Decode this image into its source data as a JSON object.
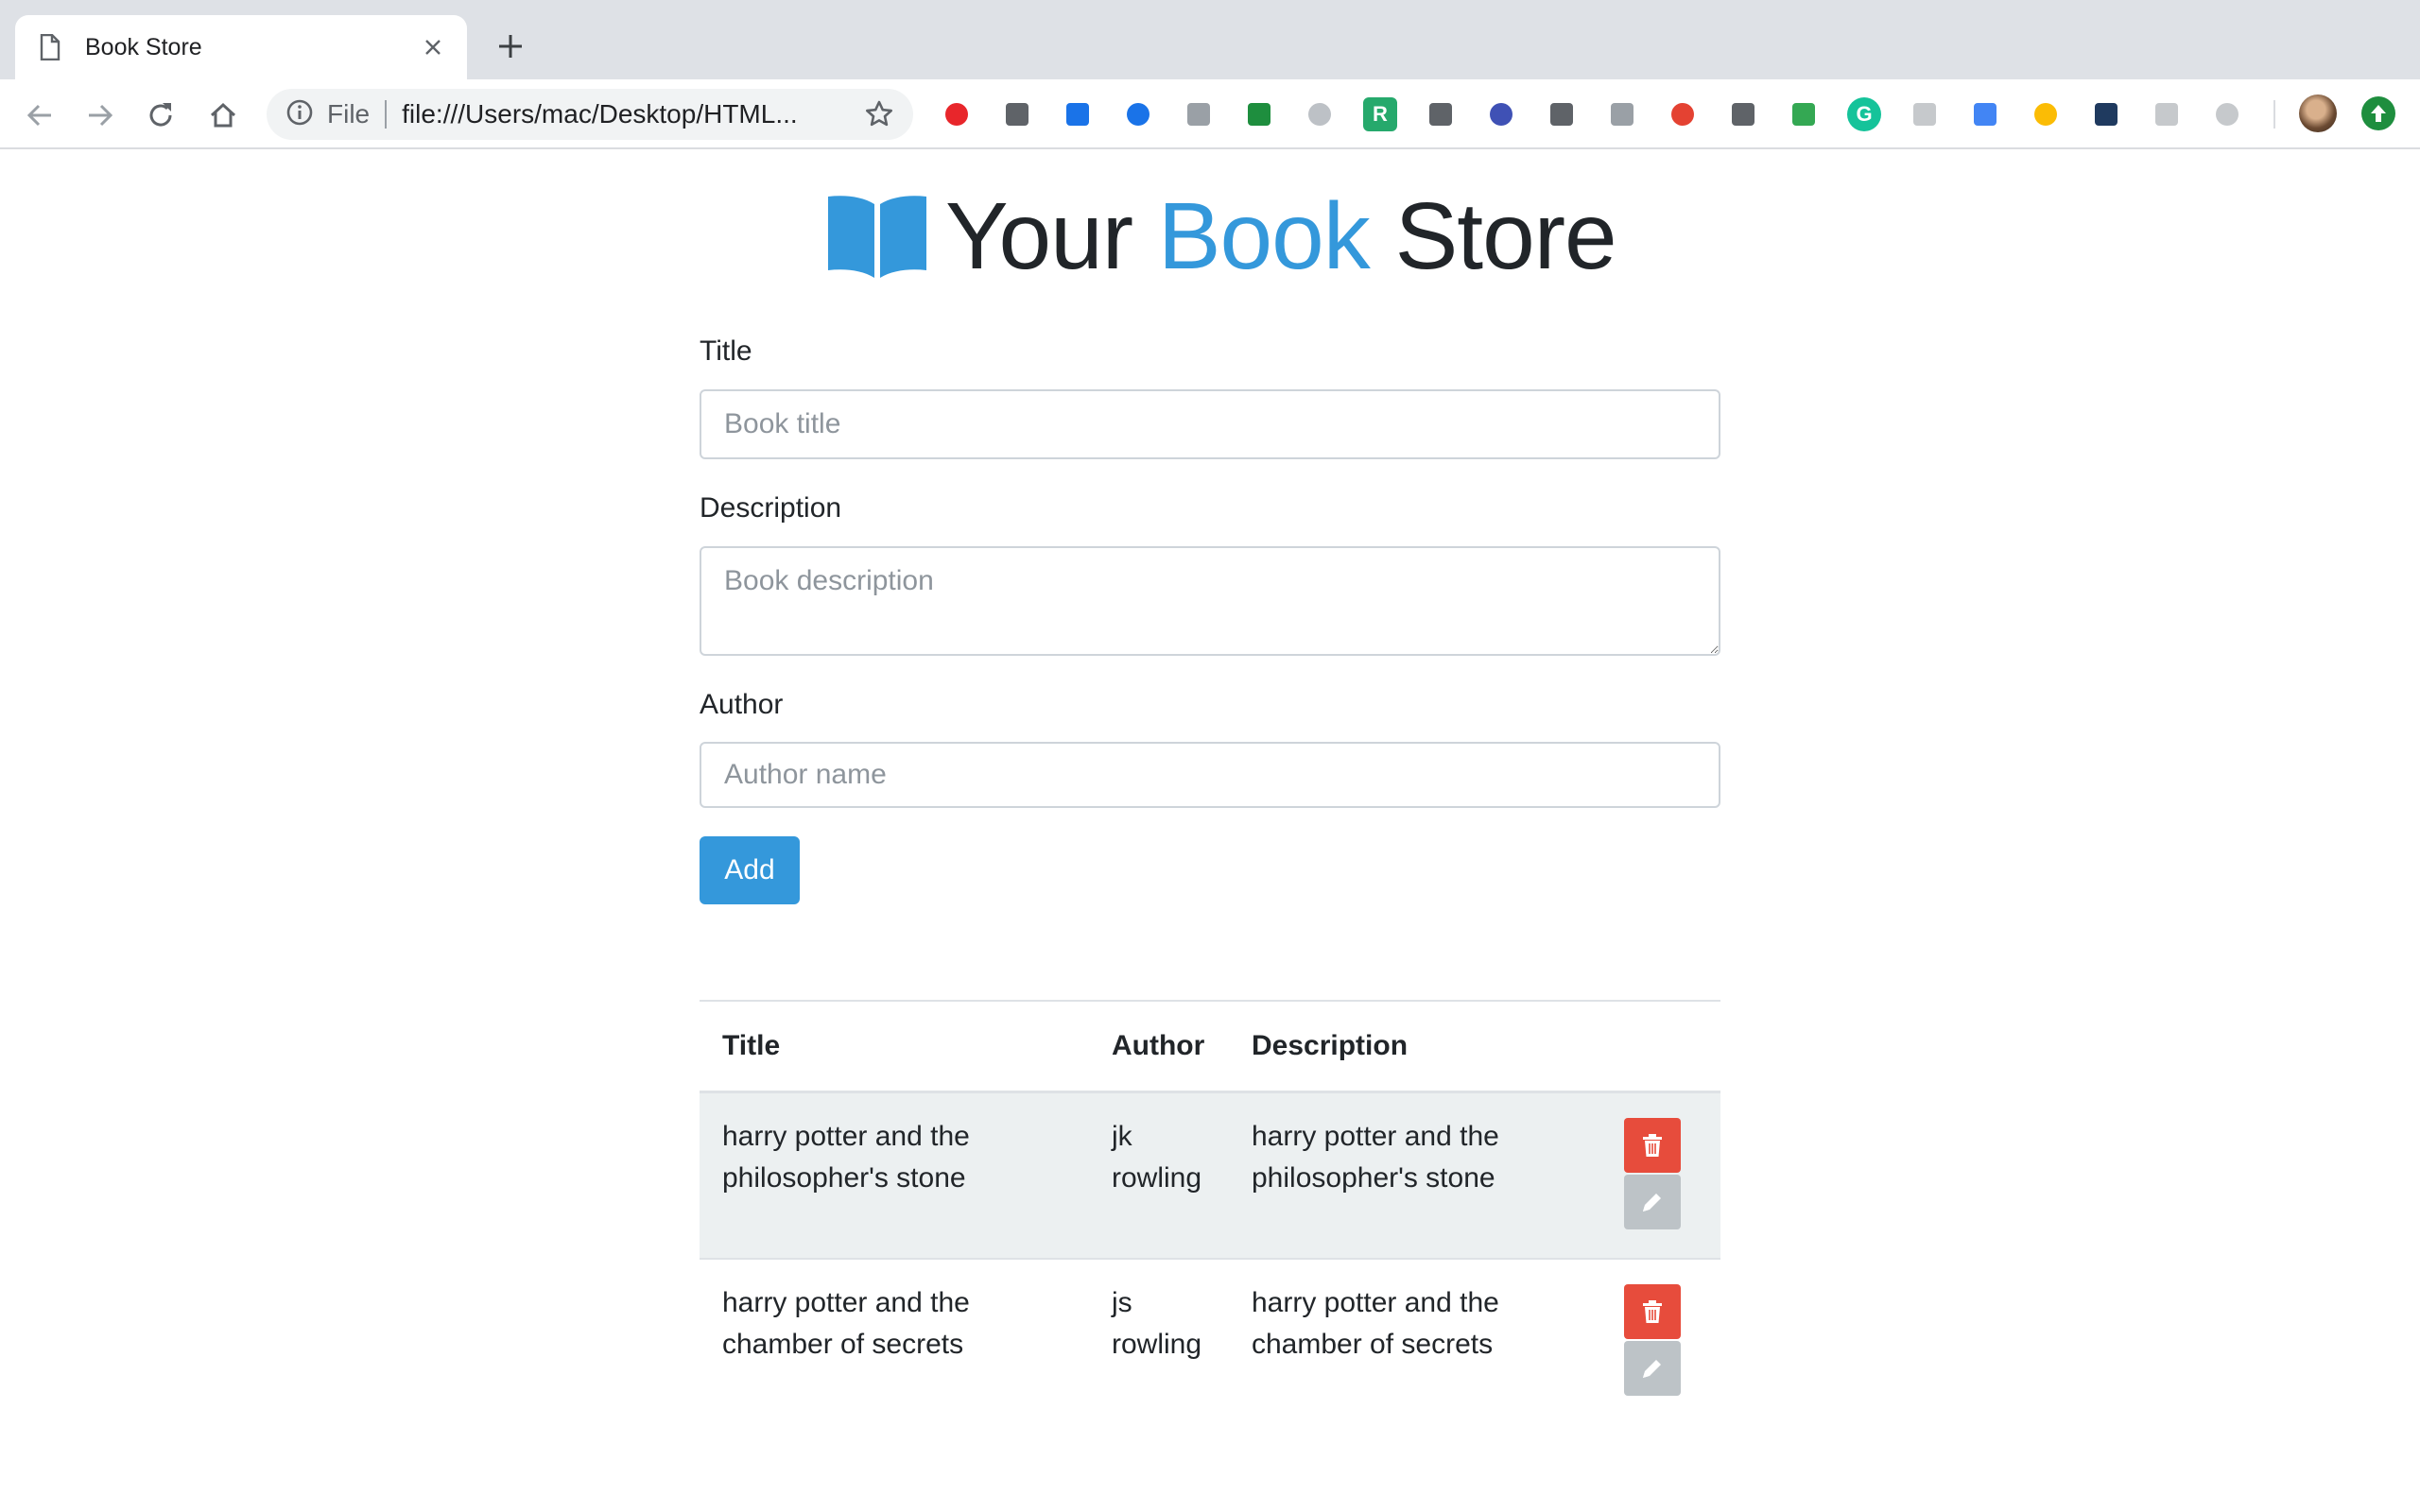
{
  "browser": {
    "tab": {
      "title": "Book Store"
    },
    "omnibox": {
      "scheme": "File",
      "url": "file:///Users/mac/Desktop/HTML..."
    },
    "extensions": [
      {
        "name": "adblock-icon",
        "color": "#e8262b"
      },
      {
        "name": "formula-icon",
        "color": "#5f6368"
      },
      {
        "name": "amazon-assistant-icon",
        "color": "#1a73e8"
      },
      {
        "name": "analytics-icon",
        "color": "#1a73e8"
      },
      {
        "name": "paint-icon",
        "color": "#9aa0a6"
      },
      {
        "name": "screenshot-frame-icon",
        "color": "#1e8e3e"
      },
      {
        "name": "camera-icon",
        "color": "#bdc1c6"
      },
      {
        "name": "r-extension-icon",
        "color": "#26a96c",
        "glyph": "R"
      },
      {
        "name": "bulb-icon",
        "color": "#5f6368"
      },
      {
        "name": "chevron-up-icon",
        "color": "#3f51b5"
      },
      {
        "name": "seo-icon",
        "color": "#5f6368"
      },
      {
        "name": "png-icon",
        "color": "#9aa0a6"
      },
      {
        "name": "todoist-icon",
        "color": "#e44232"
      },
      {
        "name": "layers-icon",
        "color": "#5f6368"
      },
      {
        "name": "eyedropper-icon",
        "color": "#34a853"
      },
      {
        "name": "grammarly-icon",
        "color": "#15c39a",
        "glyph": "G"
      },
      {
        "name": "react-devtools-icon",
        "color": "#c6c9cc"
      },
      {
        "name": "google-translate-icon",
        "color": "#4285f4"
      },
      {
        "name": "color-bars-icon",
        "color": "#fbbc05"
      },
      {
        "name": "server-icon",
        "color": "#1f3a5f"
      },
      {
        "name": "opera-icon",
        "color": "#c6c9cc"
      },
      {
        "name": "video-icon",
        "color": "#c6c9cc"
      }
    ]
  },
  "page": {
    "brand": {
      "your": "Your",
      "book": "Book",
      "store": "Store",
      "accent_color": "#3498db"
    },
    "form": {
      "title_label": "Title",
      "title_placeholder": "Book title",
      "description_label": "Description",
      "description_placeholder": "Book description",
      "author_label": "Author",
      "author_placeholder": "Author name",
      "add_label": "Add"
    },
    "table": {
      "headers": [
        "Title",
        "Author",
        "Description"
      ],
      "rows": [
        {
          "title": "harry potter and the philosopher's stone",
          "author": "jk rowling",
          "description": "harry potter and the philosopher's stone"
        },
        {
          "title": "harry potter and the chamber of secrets",
          "author": "js rowling",
          "description": "harry potter and the chamber of secrets"
        }
      ]
    },
    "colors": {
      "danger": "#e74c3c",
      "edit": "#bdc3c7",
      "primary": "#3498db",
      "stripe": "#ecf0f1"
    }
  }
}
